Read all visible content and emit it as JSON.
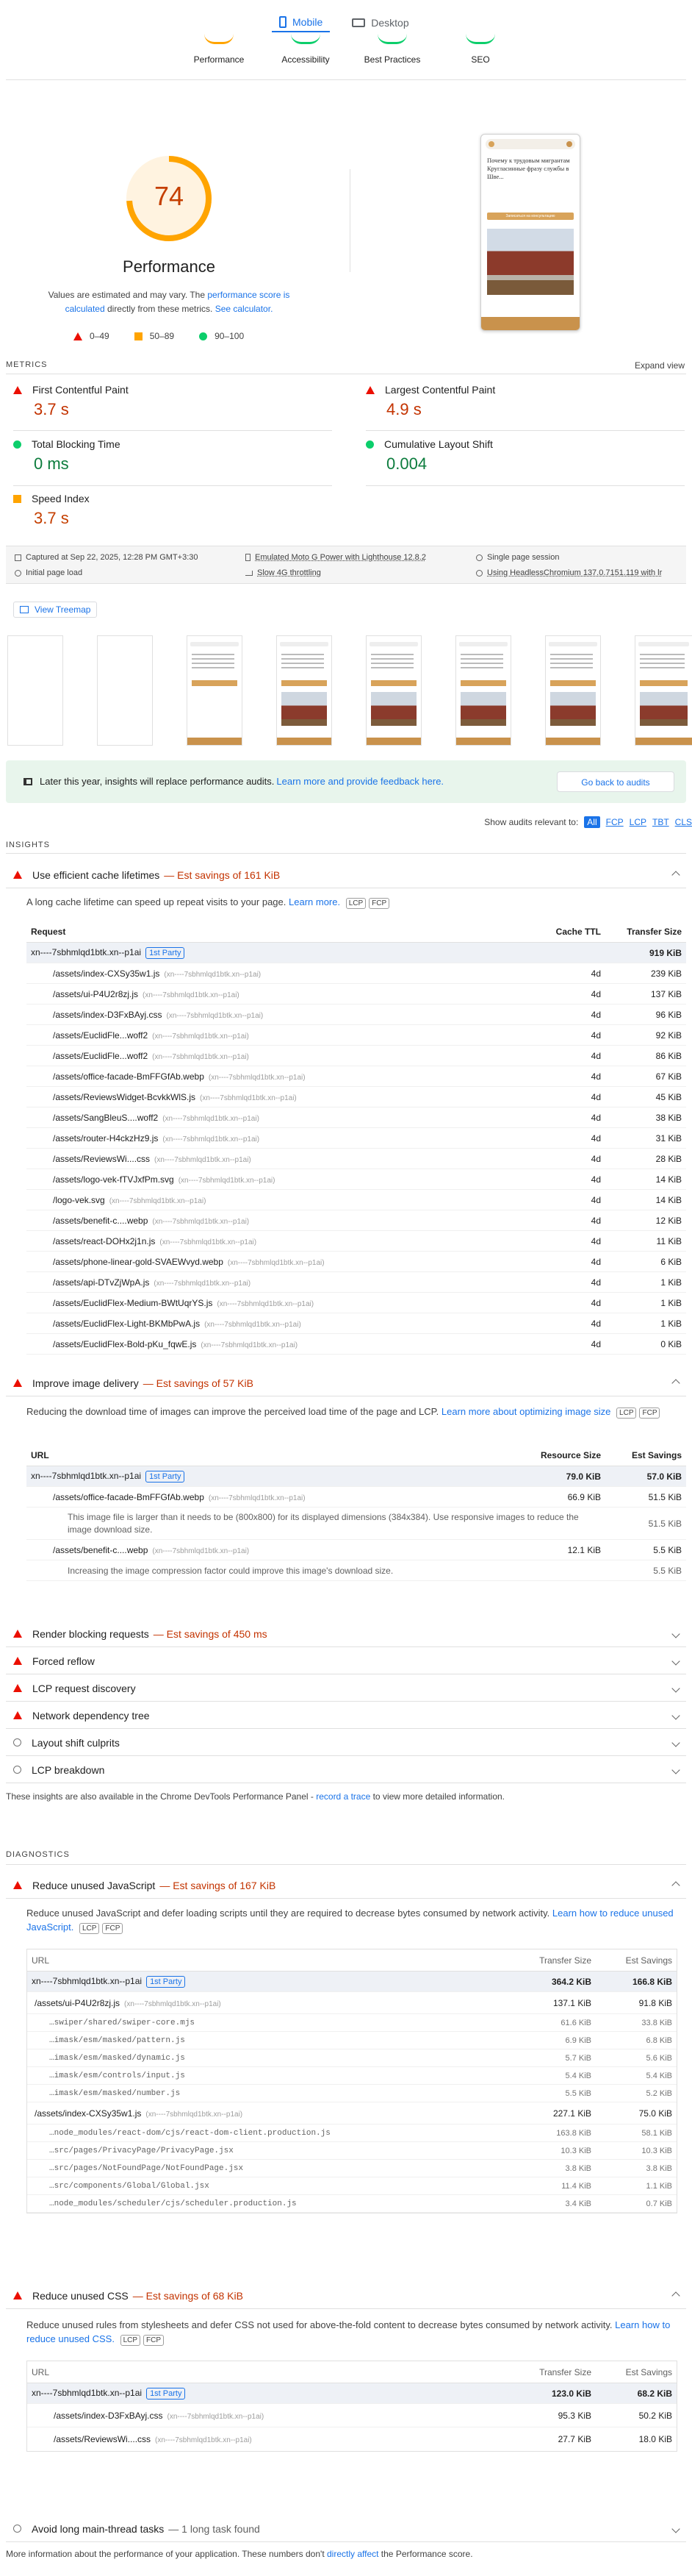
{
  "device_tabs": {
    "mobile": "Mobile",
    "desktop": "Desktop"
  },
  "category_tabs": [
    "Performance",
    "Accessibility",
    "Best Practices",
    "SEO"
  ],
  "score": {
    "value": "74",
    "title": "Performance",
    "note_prefix": "Values are estimated and may vary. The ",
    "note_link1": "performance score is calculated",
    "note_middle": " directly from these metrics. ",
    "note_link2": "See calculator.",
    "legend": [
      "0–49",
      "50–89",
      "90–100"
    ],
    "color": "#ffa400",
    "fill_fraction": 0.74
  },
  "preview": {
    "headline": "Почему к трудовым мигрантам Кругласинные фразу службы в Шве...",
    "button": "Записаться на консультацию"
  },
  "metrics": {
    "heading": "METRICS",
    "expand": "Expand view",
    "items": [
      {
        "label": "First Contentful Paint",
        "value": "3.7 s",
        "status": "fail"
      },
      {
        "label": "Largest Contentful Paint",
        "value": "4.9 s",
        "status": "fail"
      },
      {
        "label": "Total Blocking Time",
        "value": "0 ms",
        "status": "pass"
      },
      {
        "label": "Cumulative Layout Shift",
        "value": "0.004",
        "status": "pass"
      },
      {
        "label": "Speed Index",
        "value": "3.7 s",
        "status": "average"
      }
    ]
  },
  "env": {
    "captured": "Captured at Sep 22, 2025, 12:28 PM GMT+3:30",
    "emulated": "Emulated Moto G Power with Lighthouse 12.8.2",
    "session": "Single page session",
    "initial": "Initial page load",
    "throttling": "Slow 4G throttling",
    "browser": "Using HeadlessChromium 137.0.7151.119 with lr"
  },
  "treemap": "View Treemap",
  "notice": {
    "text": "Later this year, insights will replace performance audits. ",
    "link": "Learn more and provide feedback here.",
    "button": "Go back to audits"
  },
  "filter": {
    "label": "Show audits relevant to:",
    "options": [
      "All",
      "FCP",
      "LCP",
      "TBT",
      "CLS"
    ]
  },
  "insights_heading": "INSIGHTS",
  "cache": {
    "title": "Use efficient cache lifetimes",
    "savings": "— Est savings of 161 KiB",
    "desc": "A long cache lifetime can speed up repeat visits to your page. ",
    "learn": "Learn more.",
    "tags": [
      "LCP",
      "FCP"
    ],
    "cols": [
      "Request",
      "Cache TTL",
      "Transfer Size"
    ],
    "group": {
      "name": "xn----7sbhmlqd1btk.xn--p1ai",
      "party": "1st Party",
      "size": "919 KiB"
    },
    "origin": "(xn----7sbhmlqd1btk.xn--p1ai)",
    "rows": [
      [
        "/assets/index-CXSy35w1.js",
        "4d",
        "239 KiB"
      ],
      [
        "/assets/ui-P4U2r8zj.js",
        "4d",
        "137 KiB"
      ],
      [
        "/assets/index-D3FxBAyj.css",
        "4d",
        "96 KiB"
      ],
      [
        "/assets/EuclidFle...woff2",
        "4d",
        "92 KiB"
      ],
      [
        "/assets/EuclidFle...woff2",
        "4d",
        "86 KiB"
      ],
      [
        "/assets/office-facade-BmFFGfAb.webp",
        "4d",
        "67 KiB"
      ],
      [
        "/assets/ReviewsWidget-BcvkkWlS.js",
        "4d",
        "45 KiB"
      ],
      [
        "/assets/SangBleuS....woff2",
        "4d",
        "38 KiB"
      ],
      [
        "/assets/router-H4ckzHz9.js",
        "4d",
        "31 KiB"
      ],
      [
        "/assets/ReviewsWi....css",
        "4d",
        "28 KiB"
      ],
      [
        "/assets/logo-vek-fTVJxfPm.svg",
        "4d",
        "14 KiB"
      ],
      [
        "/logo-vek.svg",
        "4d",
        "14 KiB"
      ],
      [
        "/assets/benefit-c....webp",
        "4d",
        "12 KiB"
      ],
      [
        "/assets/react-DOHx2j1n.js",
        "4d",
        "11 KiB"
      ],
      [
        "/assets/phone-linear-gold-SVAEWvyd.webp",
        "4d",
        "6 KiB"
      ],
      [
        "/assets/api-DTvZjWpA.js",
        "4d",
        "1 KiB"
      ],
      [
        "/assets/EuclidFlex-Medium-BWtUqrYS.js",
        "4d",
        "1 KiB"
      ],
      [
        "/assets/EuclidFlex-Light-BKMbPwA.js",
        "4d",
        "1 KiB"
      ],
      [
        "/assets/EuclidFlex-Bold-pKu_fqwE.js",
        "4d",
        "0 KiB"
      ]
    ]
  },
  "image": {
    "title": "Improve image delivery",
    "savings": "— Est savings of 57 KiB",
    "desc": "Reducing the download time of images can improve the perceived load time of the page and LCP. ",
    "learn": "Learn more about optimizing image size",
    "tags": [
      "LCP",
      "FCP"
    ],
    "cols": [
      "URL",
      "Resource Size",
      "Est Savings"
    ],
    "group": {
      "name": "xn----7sbhmlqd1btk.xn--p1ai",
      "party": "1st Party",
      "size": "79.0 KiB",
      "savings": "57.0 KiB"
    },
    "rows": [
      {
        "url": "/assets/office-facade-BmFFGfAb.webp",
        "size": "66.9 KiB",
        "savings": "51.5 KiB",
        "note": "This image file is larger than it needs to be (800x800) for its displayed dimensions (384x384). Use responsive images to reduce the image download size.",
        "note_savings": "51.5 KiB"
      },
      {
        "url": "/assets/benefit-c....webp",
        "size": "12.1 KiB",
        "savings": "5.5 KiB",
        "note": "Increasing the image compression factor could improve this image's download size.",
        "note_savings": "5.5 KiB"
      }
    ]
  },
  "collapsed_insights": [
    {
      "title": "Render blocking requests",
      "savings": "— Est savings of 450 ms",
      "status": "fail"
    },
    {
      "title": "Forced reflow",
      "savings": "",
      "status": "fail"
    },
    {
      "title": "LCP request discovery",
      "savings": "",
      "status": "fail"
    },
    {
      "title": "Network dependency tree",
      "savings": "",
      "status": "fail"
    },
    {
      "title": "Layout shift culprits",
      "savings": "",
      "status": "info"
    },
    {
      "title": "LCP breakdown",
      "savings": "",
      "status": "info"
    }
  ],
  "insights_footer": {
    "prefix": "These insights are also available in the Chrome DevTools Performance Panel - ",
    "link": "record a trace",
    "suffix": " to view more detailed information."
  },
  "diagnostics_heading": "DIAGNOSTICS",
  "unused_js": {
    "title": "Reduce unused JavaScript",
    "savings": "— Est savings of 167 KiB",
    "desc": "Reduce unused JavaScript and defer loading scripts until they are required to decrease bytes consumed by network activity. ",
    "learn": "Learn how to reduce unused JavaScript.",
    "tags": [
      "LCP",
      "FCP"
    ],
    "cols": [
      "URL",
      "Transfer Size",
      "Est Savings"
    ],
    "group": {
      "name": "xn----7sbhmlqd1btk.xn--p1ai",
      "party": "1st Party",
      "size": "364.2 KiB",
      "savings": "166.8 KiB"
    },
    "files": [
      {
        "url": "/assets/ui-P4U2r8zj.js",
        "size": "137.1 KiB",
        "savings": "91.8 KiB",
        "children": [
          [
            "…swiper/shared/swiper-core.mjs",
            "61.6 KiB",
            "33.8 KiB"
          ],
          [
            "…imask/esm/masked/pattern.js",
            "6.9 KiB",
            "6.8 KiB"
          ],
          [
            "…imask/esm/masked/dynamic.js",
            "5.7 KiB",
            "5.6 KiB"
          ],
          [
            "…imask/esm/controls/input.js",
            "5.4 KiB",
            "5.4 KiB"
          ],
          [
            "…imask/esm/masked/number.js",
            "5.5 KiB",
            "5.2 KiB"
          ]
        ]
      },
      {
        "url": "/assets/index-CXSy35w1.js",
        "size": "227.1 KiB",
        "savings": "75.0 KiB",
        "children": [
          [
            "…node_modules/react-dom/cjs/react-dom-client.production.js",
            "163.8 KiB",
            "58.1 KiB"
          ],
          [
            "…src/pages/PrivacyPage/PrivacyPage.jsx",
            "10.3 KiB",
            "10.3 KiB"
          ],
          [
            "…src/pages/NotFoundPage/NotFoundPage.jsx",
            "3.8 KiB",
            "3.8 KiB"
          ],
          [
            "…src/components/Global/Global.jsx",
            "11.4 KiB",
            "1.1 KiB"
          ],
          [
            "…node_modules/scheduler/cjs/scheduler.production.js",
            "3.4 KiB",
            "0.7 KiB"
          ]
        ]
      }
    ]
  },
  "unused_css": {
    "title": "Reduce unused CSS",
    "savings": "— Est savings of 68 KiB",
    "desc": "Reduce unused rules from stylesheets and defer CSS not used for above-the-fold content to decrease bytes consumed by network activity. ",
    "learn": "Learn how to reduce unused CSS.",
    "tags": [
      "LCP",
      "FCP"
    ],
    "cols": [
      "URL",
      "Transfer Size",
      "Est Savings"
    ],
    "group": {
      "name": "xn----7sbhmlqd1btk.xn--p1ai",
      "party": "1st Party",
      "size": "123.0 KiB",
      "savings": "68.2 KiB"
    },
    "rows": [
      [
        "/assets/index-D3FxBAyj.css",
        "95.3 KiB",
        "50.2 KiB"
      ],
      [
        "/assets/ReviewsWi....css",
        "27.7 KiB",
        "18.0 KiB"
      ]
    ]
  },
  "long_tasks": {
    "title": "Avoid long main-thread tasks",
    "savings": "— 1 long task found"
  },
  "footer": {
    "prefix": "More information about the performance of your application. These numbers don't ",
    "link": "directly affect",
    "suffix": " the Performance score."
  }
}
